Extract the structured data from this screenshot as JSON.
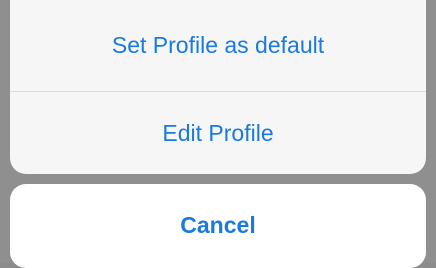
{
  "action_sheet": {
    "actions": [
      {
        "label": "Set Profile as default"
      },
      {
        "label": "Edit Profile"
      }
    ],
    "cancel_label": "Cancel"
  },
  "colors": {
    "accent": "#1a7ae0",
    "sheet_background": "#f6f6f6",
    "cancel_background": "#ffffff",
    "dimmed_backdrop": "#8f8f8f"
  }
}
